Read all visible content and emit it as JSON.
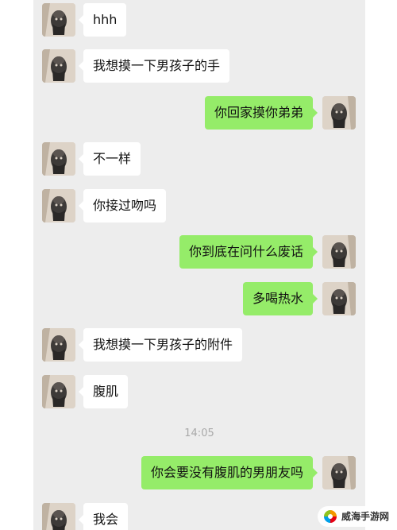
{
  "messages": [
    {
      "side": "in",
      "text": "hhh"
    },
    {
      "side": "in",
      "text": "我想摸一下男孩子的手"
    },
    {
      "side": "out",
      "text": "你回家摸你弟弟"
    },
    {
      "side": "in",
      "text": "不一样"
    },
    {
      "side": "in",
      "text": "你接过吻吗"
    },
    {
      "side": "out",
      "text": "你到底在问什么废话"
    },
    {
      "side": "out",
      "text": "多喝热水"
    },
    {
      "side": "in",
      "text": "我想摸一下男孩子的附件"
    },
    {
      "side": "in",
      "text": "腹肌"
    },
    {
      "side": "out",
      "text": "你会要没有腹肌的男朋友吗"
    },
    {
      "side": "in",
      "text": "我会"
    }
  ],
  "timestamp": "14:05",
  "watermark": {
    "text": "威海手游网",
    "icon": "swirl-logo-icon",
    "accent": "#f39800"
  },
  "colors": {
    "chat_background": "#ededed",
    "incoming_bubble": "#ffffff",
    "outgoing_bubble": "#95ec69"
  }
}
